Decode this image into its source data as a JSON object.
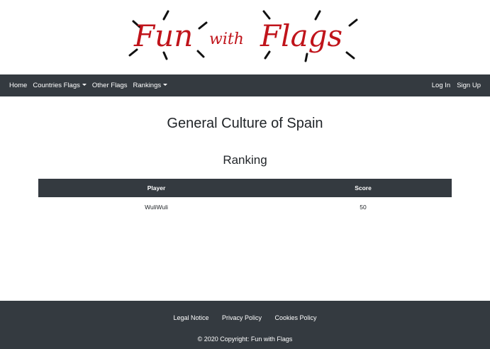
{
  "logo": {
    "word_fun": "Fun",
    "word_with": "with",
    "word_flags": "Flags",
    "color": "#c0141b"
  },
  "nav": {
    "home": "Home",
    "countries_flags": "Countries Flags",
    "other_flags": "Other Flags",
    "rankings": "Rankings",
    "log_in": "Log In",
    "sign_up": "Sign Up",
    "background": "#343a40"
  },
  "main": {
    "title": "General Culture of Spain",
    "section_title": "Ranking",
    "table": {
      "headers": [
        "Player",
        "Score"
      ],
      "rows": [
        [
          "WuliWuli",
          "50"
        ]
      ]
    }
  },
  "footer": {
    "links": [
      "Legal Notice",
      "Privacy Policy",
      "Cookies Policy"
    ],
    "copyright": "© 2020 Copyright: Fun with Flags"
  }
}
